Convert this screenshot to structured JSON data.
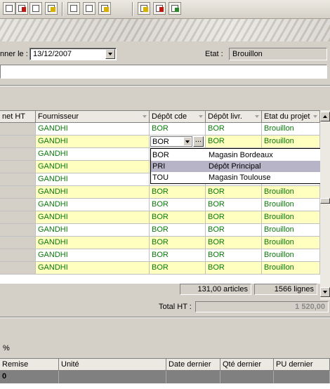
{
  "toolbar": {
    "buttons": [
      "doc-icon",
      "doc-icon",
      "print-icon",
      "mail-icon",
      "stack-icon",
      "report-icon",
      "folder-icon",
      "sheet-icon",
      "flag-icon",
      "money-bag-icon"
    ]
  },
  "form": {
    "date_label": "nner le :",
    "date_value": "13/12/2007",
    "etat_label": "Etat :",
    "etat_value": "Brouillon"
  },
  "grid": {
    "columns": [
      "net HT",
      "Fournisseur",
      "Dépôt cde",
      "Dépôt livr.",
      "Etat du projet"
    ],
    "rows": [
      {
        "fournisseur": "GANDHI",
        "depot_cde": "BOR",
        "depot_livr": "BOR",
        "etat": "Brouillon"
      },
      {
        "fournisseur": "GANDHI",
        "depot_cde": "BOR",
        "depot_livr": "BOR",
        "etat": "Brouillon"
      },
      {
        "fournisseur": "GANDHI",
        "depot_cde": "",
        "depot_livr": "",
        "etat": ""
      },
      {
        "fournisseur": "GANDHI",
        "depot_cde": "",
        "depot_livr": "",
        "etat": ""
      },
      {
        "fournisseur": "GANDHI",
        "depot_cde": "",
        "depot_livr": "",
        "etat": ""
      },
      {
        "fournisseur": "GANDHI",
        "depot_cde": "BOR",
        "depot_livr": "BOR",
        "etat": "Brouillon"
      },
      {
        "fournisseur": "GANDHI",
        "depot_cde": "BOR",
        "depot_livr": "BOR",
        "etat": "Brouillon"
      },
      {
        "fournisseur": "GANDHI",
        "depot_cde": "BOR",
        "depot_livr": "BOR",
        "etat": "Brouillon"
      },
      {
        "fournisseur": "GANDHI",
        "depot_cde": "BOR",
        "depot_livr": "BOR",
        "etat": "Brouillon"
      },
      {
        "fournisseur": "GANDHI",
        "depot_cde": "BOR",
        "depot_livr": "BOR",
        "etat": "Brouillon"
      },
      {
        "fournisseur": "GANDHI",
        "depot_cde": "BOR",
        "depot_livr": "BOR",
        "etat": "Brouillon"
      },
      {
        "fournisseur": "GANDHI",
        "depot_cde": "BOR",
        "depot_livr": "BOR",
        "etat": "Brouillon"
      }
    ],
    "editor": {
      "value": "BOR",
      "browse_label": "..."
    }
  },
  "dropdown": {
    "items": [
      {
        "code": "BOR",
        "label": "Magasin Bordeaux"
      },
      {
        "code": "PRI",
        "label": "Dépôt Principal"
      },
      {
        "code": "TOU",
        "label": "Magasin Toulouse"
      }
    ],
    "selected_index": 1
  },
  "summary": {
    "articles": "131,00 articles",
    "lignes": "1566 lignes",
    "total_label": "Total HT :",
    "total_value": "1 520,00"
  },
  "bottom": {
    "percent_label": "%",
    "columns": [
      "Remise",
      "Unité",
      "Date dernier",
      "Qté dernier",
      "PU dernier"
    ],
    "row_first": "0"
  },
  "colors": {
    "row_yellow": "#ffffc0",
    "row_white": "#ffffff",
    "text_green": "#0a7a0a",
    "selection": "#b8b4c8"
  }
}
